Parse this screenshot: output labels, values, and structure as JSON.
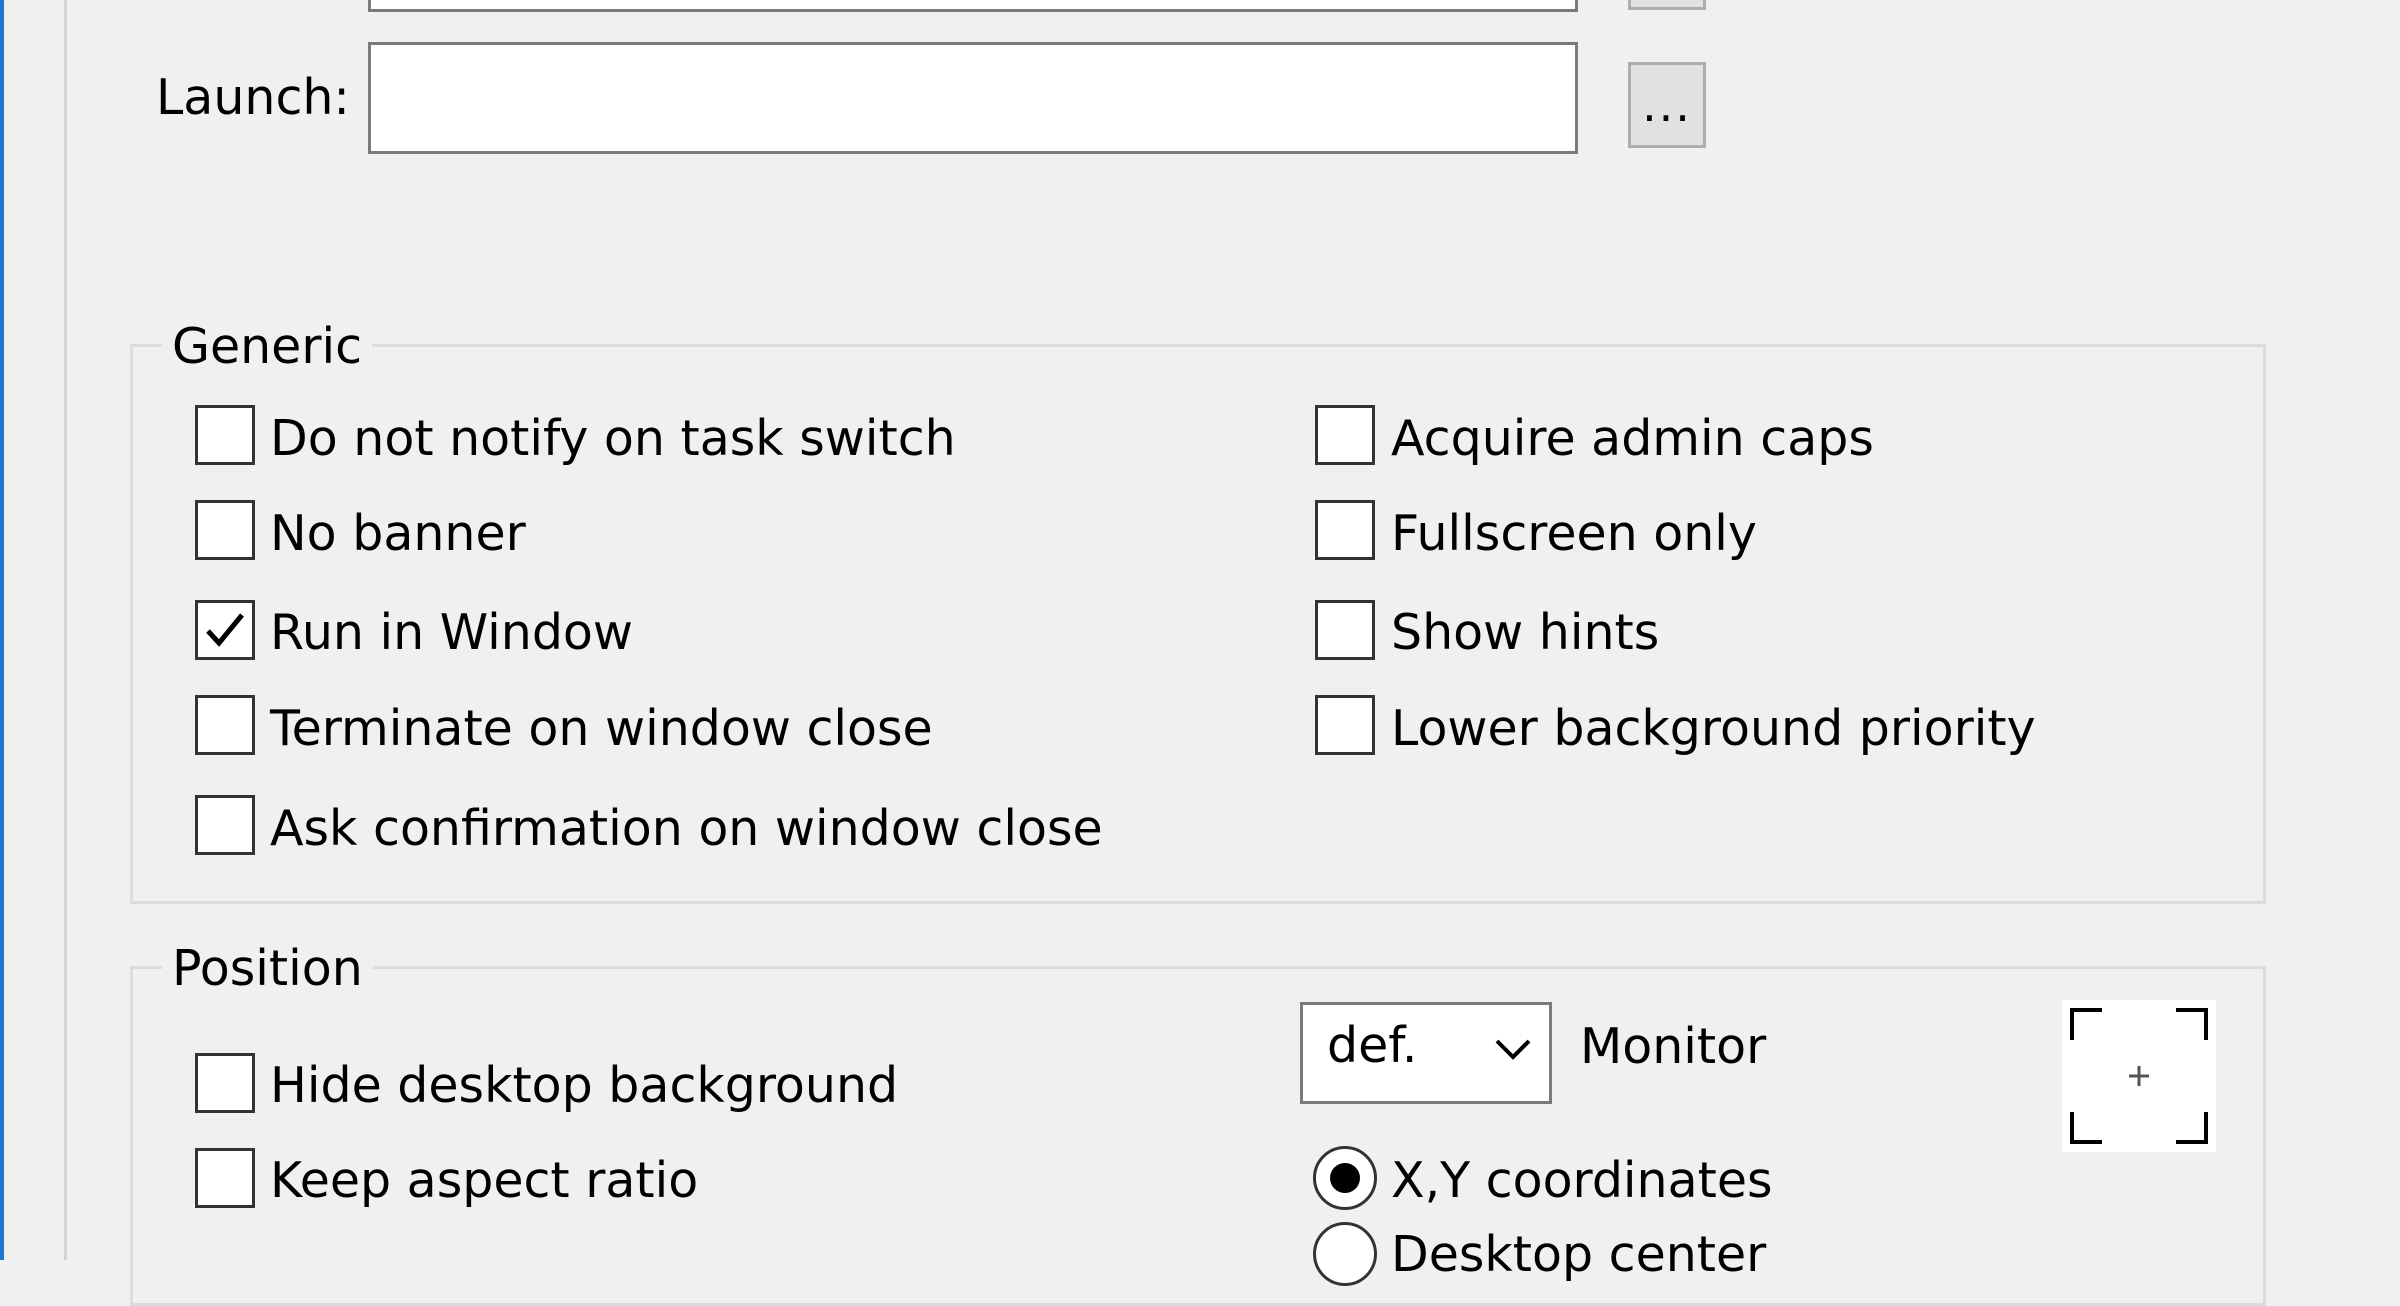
{
  "launch": {
    "label": "Launch:",
    "value": "",
    "browse_label": "..."
  },
  "generic": {
    "title": "Generic",
    "left_options": [
      {
        "label": "Do not notify on task switch",
        "checked": false
      },
      {
        "label": "No banner",
        "checked": false
      },
      {
        "label": "Run in Window",
        "checked": true
      },
      {
        "label": "Terminate on window close",
        "checked": false
      },
      {
        "label": "Ask confirmation on window close",
        "checked": false
      }
    ],
    "right_options": [
      {
        "label": "Acquire admin caps",
        "checked": false
      },
      {
        "label": "Fullscreen only",
        "checked": false
      },
      {
        "label": "Show hints",
        "checked": false
      },
      {
        "label": "Lower background priority",
        "checked": false
      }
    ]
  },
  "position": {
    "title": "Position",
    "options": [
      {
        "label": "Hide desktop background",
        "checked": false
      },
      {
        "label": "Keep aspect ratio",
        "checked": false
      }
    ],
    "monitor_select": "def.",
    "monitor_label": "Monitor",
    "picker_icon": "crosshair-frame-icon",
    "radios": [
      {
        "label": "X,Y coordinates",
        "selected": true
      },
      {
        "label": "Desktop center",
        "selected": false
      }
    ]
  }
}
